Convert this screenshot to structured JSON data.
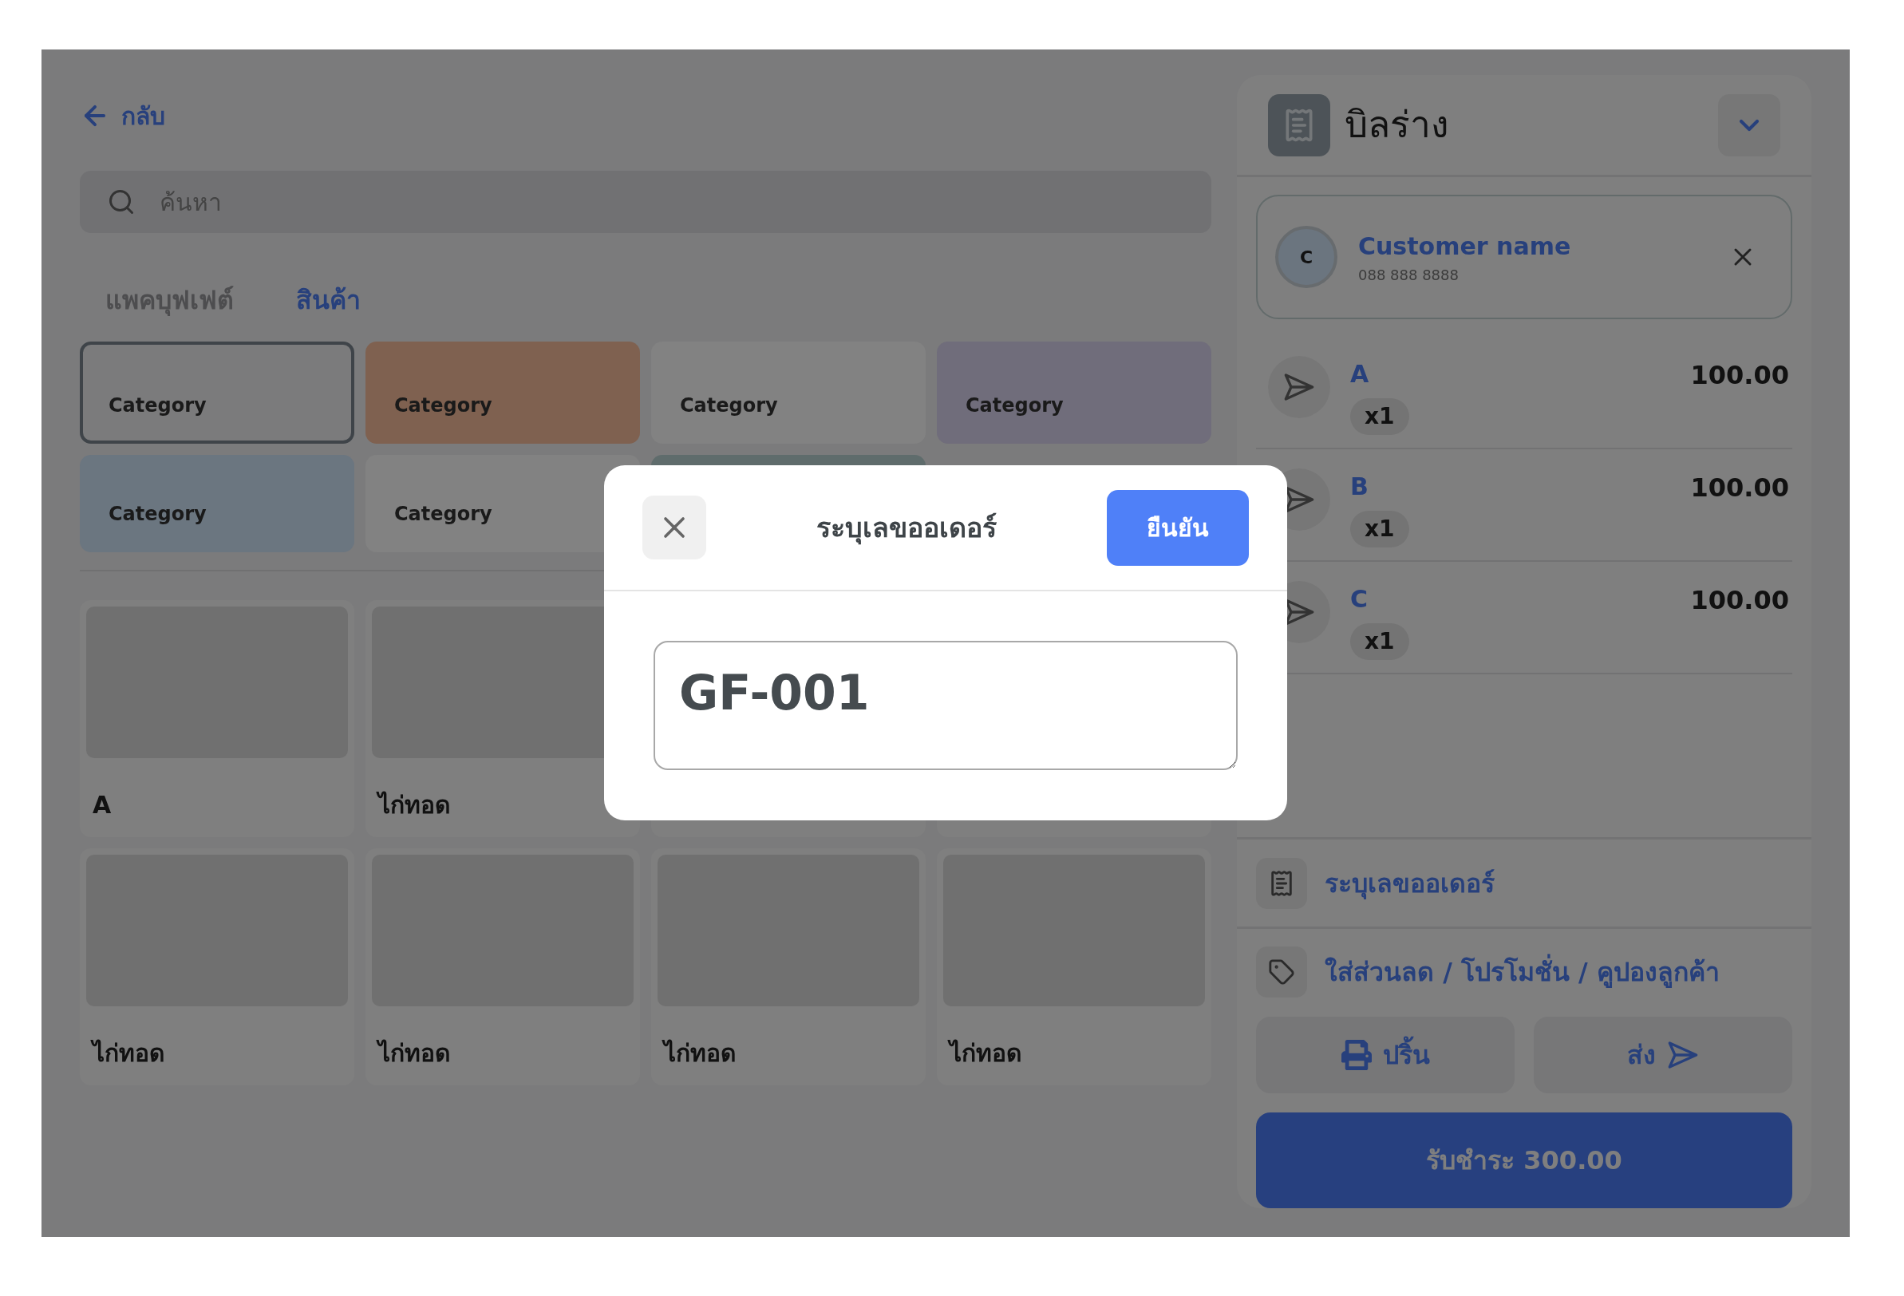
{
  "back_link": {
    "label": "กลับ"
  },
  "search": {
    "placeholder": "ค้นหา"
  },
  "tabs": [
    {
      "label": "แพคบุฟเฟต์",
      "selected": false
    },
    {
      "label": "สินค้า",
      "selected": true
    }
  ],
  "categories": [
    {
      "kind": "item",
      "label": "Category",
      "selected": true,
      "color": "#7b7b7c"
    },
    {
      "kind": "item",
      "label": "Category",
      "selected": false,
      "color": "#7f6150"
    },
    {
      "kind": "item",
      "label": "Category",
      "selected": false,
      "color": "#828282"
    },
    {
      "kind": "item",
      "label": "Category",
      "selected": false,
      "color": "#706d7b"
    },
    {
      "kind": "item",
      "label": "Category",
      "selected": false,
      "color": "#6b7680"
    },
    {
      "kind": "item",
      "label": "Category",
      "selected": false,
      "color": "#828282"
    },
    {
      "kind": "covered",
      "selected": false,
      "color": "#5f6c6c"
    }
  ],
  "products": [
    {
      "kind": "item",
      "name": "A"
    },
    {
      "kind": "item",
      "name": "ไก่ทอด"
    },
    {
      "kind": "covered"
    },
    {
      "kind": "covered"
    },
    {
      "kind": "item",
      "name": "ไก่ทอด"
    },
    {
      "kind": "item",
      "name": "ไก่ทอด"
    },
    {
      "kind": "item",
      "name": "ไก่ทอด"
    },
    {
      "kind": "item",
      "name": "ไก่ทอด"
    }
  ],
  "bill": {
    "title": "บิลร่าง"
  },
  "customer": {
    "initial": "C",
    "name": "Customer name",
    "phone": "088 888 8888"
  },
  "cart_items": [
    {
      "name": "A",
      "qty": "x1",
      "price": "100.00"
    },
    {
      "name": "B",
      "qty": "x1",
      "price": "100.00"
    },
    {
      "name": "C",
      "qty": "x1",
      "price": "100.00"
    }
  ],
  "order_number_action": {
    "label": "ระบุเลขออเดอร์"
  },
  "discount_action": {
    "label": "ใส่ส่วนลด / โปรโมชั่น / คูปองลูกค้า"
  },
  "print_button": {
    "label": "ปริ้น"
  },
  "send_button": {
    "label": "ส่ง"
  },
  "pay_button": {
    "label": "รับชำระ 300.00"
  },
  "dialog": {
    "title": "ระบุเลขออเดอร์",
    "confirm": "ยืนยัน",
    "value": "GF-001"
  }
}
